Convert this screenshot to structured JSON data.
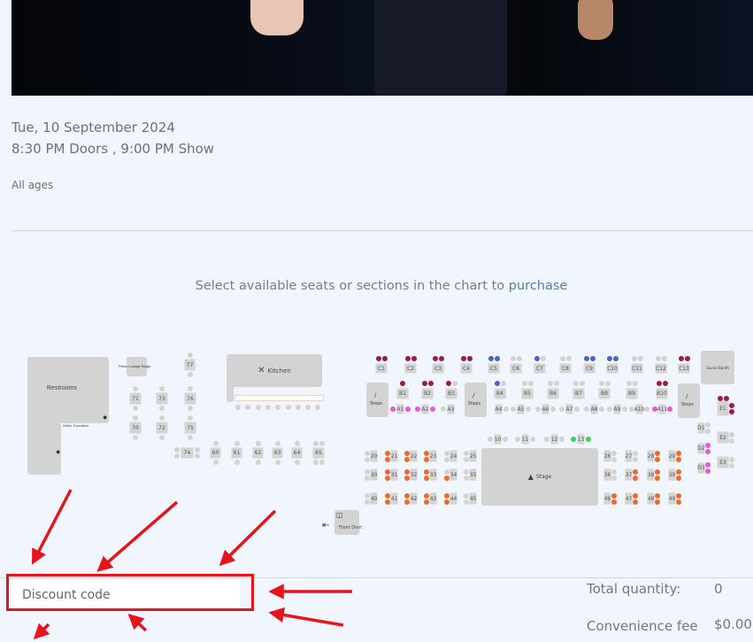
{
  "event": {
    "date": "Tue, 10 September 2024",
    "times": "8:30 PM Doors , 9:00 PM Show",
    "age_restriction": "All ages"
  },
  "seat_prompt": {
    "text": "Select available seats or sections in the chart to ",
    "link": "purchase"
  },
  "seat_map": {
    "colors": {
      "maroon": "#9b1b46",
      "blue": "#4c62c4",
      "grey": "#d3d3d3",
      "pink": "#e45bd8",
      "orange": "#f0692a",
      "green": "#3dd05c"
    },
    "areas": {
      "restrooms": "Restrooms",
      "water_fountains": "Water Fountains",
      "piano_lounge_stage": "Piano Lounge Stage",
      "kitchen": "Kitchen",
      "sound_booth": "Sound Booth",
      "steps": "Steps",
      "stage": "Stage",
      "front_door": "Front Door"
    },
    "tables": [
      {
        "label": "C1",
        "seats": [
          "maroon",
          "maroon"
        ]
      },
      {
        "label": "C2",
        "seats": [
          "maroon",
          "maroon"
        ]
      },
      {
        "label": "C3",
        "seats": [
          "maroon",
          "maroon"
        ]
      },
      {
        "label": "C4",
        "seats": [
          "maroon",
          "maroon"
        ]
      },
      {
        "label": "C5",
        "seats": [
          "blue",
          "blue"
        ]
      },
      {
        "label": "C6",
        "seats": [
          "grey",
          "grey"
        ]
      },
      {
        "label": "C7",
        "seats": [
          "blue",
          "grey"
        ]
      },
      {
        "label": "C8",
        "seats": [
          "grey",
          "grey"
        ]
      },
      {
        "label": "C9",
        "seats": [
          "blue",
          "blue"
        ]
      },
      {
        "label": "C10",
        "seats": [
          "blue",
          "blue"
        ]
      },
      {
        "label": "C11",
        "seats": [
          "grey",
          "grey"
        ]
      },
      {
        "label": "C12",
        "seats": [
          "grey",
          "grey"
        ]
      },
      {
        "label": "C13",
        "seats": [
          "maroon",
          "maroon"
        ]
      },
      {
        "label": "B1",
        "seats": [
          "maroon"
        ]
      },
      {
        "label": "B2",
        "seats": [
          "maroon",
          "maroon"
        ]
      },
      {
        "label": "B3",
        "seats": [
          "maroon",
          "grey"
        ]
      },
      {
        "label": "B4",
        "seats": [
          "blue",
          "grey"
        ]
      },
      {
        "label": "B5",
        "seats": [
          "grey",
          "grey"
        ]
      },
      {
        "label": "B6",
        "seats": [
          "grey",
          "grey"
        ]
      },
      {
        "label": "B7",
        "seats": [
          "grey",
          "grey"
        ]
      },
      {
        "label": "B8",
        "seats": [
          "grey",
          "grey"
        ]
      },
      {
        "label": "B9",
        "seats": [
          "grey",
          "grey"
        ]
      },
      {
        "label": "B10",
        "seats": [
          "maroon",
          "maroon"
        ]
      },
      {
        "label": "A1",
        "seats": [
          "pink",
          "pink"
        ]
      },
      {
        "label": "A2",
        "seats": [
          "pink",
          "pink"
        ]
      },
      {
        "label": "A3",
        "seats": [
          "grey"
        ]
      },
      {
        "label": "A4",
        "seats": [
          null,
          "grey"
        ]
      },
      {
        "label": "A5",
        "seats": [
          "grey",
          "grey"
        ]
      },
      {
        "label": "A6",
        "seats": [
          "grey",
          "grey"
        ]
      },
      {
        "label": "A7",
        "seats": [
          "grey",
          "grey"
        ]
      },
      {
        "label": "A8",
        "seats": [
          "grey",
          "grey"
        ]
      },
      {
        "label": "A9",
        "seats": [
          "grey",
          "grey"
        ]
      },
      {
        "label": "A10",
        "seats": [
          "grey",
          "grey"
        ]
      },
      {
        "label": "A11",
        "seats": [
          "pink",
          "pink"
        ]
      },
      {
        "label": "10",
        "seats": [
          "grey",
          "grey"
        ]
      },
      {
        "label": "11",
        "seats": [
          "grey",
          "grey"
        ]
      },
      {
        "label": "12",
        "seats": [
          "grey",
          "grey"
        ]
      },
      {
        "label": "13",
        "seats": [
          "green",
          "green"
        ]
      },
      {
        "label": "20",
        "seats": [
          "grey",
          "grey"
        ]
      },
      {
        "label": "21",
        "seats": [
          "orange",
          "orange"
        ]
      },
      {
        "label": "22",
        "seats": [
          "orange",
          "orange"
        ]
      },
      {
        "label": "23",
        "seats": [
          "orange",
          "orange"
        ]
      },
      {
        "label": "24",
        "seats": [
          "grey",
          "grey"
        ]
      },
      {
        "label": "25",
        "seats": [
          "grey",
          "grey"
        ]
      },
      {
        "label": "30",
        "seats": [
          "grey",
          "grey"
        ]
      },
      {
        "label": "31",
        "seats": [
          "orange",
          "orange"
        ]
      },
      {
        "label": "32",
        "seats": [
          "orange",
          "orange"
        ]
      },
      {
        "label": "33",
        "seats": [
          "orange",
          "orange"
        ]
      },
      {
        "label": "34",
        "seats": [
          "grey",
          "orange"
        ]
      },
      {
        "label": "35",
        "seats": [
          "grey",
          "grey"
        ]
      },
      {
        "label": "40",
        "seats": [
          "grey",
          "grey"
        ]
      },
      {
        "label": "41",
        "seats": [
          "orange",
          "orange"
        ]
      },
      {
        "label": "42",
        "seats": [
          "orange",
          "orange"
        ]
      },
      {
        "label": "43",
        "seats": [
          "orange",
          "orange"
        ]
      },
      {
        "label": "44",
        "seats": [
          "orange",
          "orange"
        ]
      },
      {
        "label": "45",
        "seats": [
          "grey",
          "grey"
        ]
      },
      {
        "label": "26",
        "seats": [
          "grey",
          "grey"
        ]
      },
      {
        "label": "27",
        "seats": [
          "grey",
          "grey"
        ]
      },
      {
        "label": "28",
        "seats": [
          "orange",
          "orange"
        ]
      },
      {
        "label": "29",
        "seats": [
          "orange",
          "orange"
        ]
      },
      {
        "label": "36",
        "seats": [
          "grey",
          "grey"
        ]
      },
      {
        "label": "37",
        "seats": [
          "orange",
          "orange"
        ]
      },
      {
        "label": "38",
        "seats": [
          "orange",
          "orange"
        ]
      },
      {
        "label": "39",
        "seats": [
          "orange",
          "orange"
        ]
      },
      {
        "label": "46",
        "seats": [
          "orange",
          "orange"
        ]
      },
      {
        "label": "47",
        "seats": [
          "orange",
          "orange"
        ]
      },
      {
        "label": "48",
        "seats": [
          "orange",
          "orange"
        ]
      },
      {
        "label": "49",
        "seats": [
          "orange",
          "orange"
        ]
      },
      {
        "label": "D1",
        "seats": [
          "grey",
          "grey"
        ]
      },
      {
        "label": "D2",
        "seats": [
          "pink",
          "pink"
        ]
      },
      {
        "label": "D3",
        "seats": [
          "pink",
          "pink"
        ]
      },
      {
        "label": "E1",
        "seats": [
          "maroon",
          "maroon",
          "maroon",
          "maroon"
        ]
      },
      {
        "label": "E2",
        "seats": [
          "grey",
          "grey"
        ]
      },
      {
        "label": "E3",
        "seats": [
          "grey",
          "grey"
        ]
      },
      {
        "label": "77",
        "seats": [
          "grey",
          "grey"
        ]
      },
      {
        "label": "71",
        "seats": [
          "grey",
          "grey"
        ]
      },
      {
        "label": "73",
        "seats": [
          "grey",
          "grey"
        ]
      },
      {
        "label": "76",
        "seats": [
          "grey",
          "grey"
        ]
      },
      {
        "label": "70",
        "seats": [
          "grey",
          "grey"
        ]
      },
      {
        "label": "72",
        "seats": [
          "grey",
          "grey"
        ]
      },
      {
        "label": "75",
        "seats": [
          "grey",
          "grey"
        ]
      },
      {
        "label": "74",
        "seats": [
          "grey",
          "grey",
          "grey",
          "grey"
        ]
      },
      {
        "label": "60",
        "seats": [
          "grey",
          "grey"
        ]
      },
      {
        "label": "61",
        "seats": [
          "grey",
          "grey"
        ]
      },
      {
        "label": "62",
        "seats": [
          "grey",
          "grey"
        ]
      },
      {
        "label": "63",
        "seats": [
          "grey",
          "grey"
        ]
      },
      {
        "label": "64",
        "seats": [
          "grey",
          "grey"
        ]
      },
      {
        "label": "65",
        "seats": [
          "grey",
          "grey",
          "grey",
          "grey"
        ]
      }
    ],
    "bar_seats": [
      "grey",
      "grey",
      "grey",
      "grey",
      "grey",
      "grey",
      "grey",
      "grey",
      "grey"
    ]
  },
  "discount": {
    "placeholder": "Discount code"
  },
  "summary": {
    "total_quantity_label": "Total quantity:",
    "total_quantity_value": "0",
    "convenience_fee_label": "Convenience fee",
    "convenience_fee_value": "$0.00"
  },
  "annotation_color": "#e8141c"
}
